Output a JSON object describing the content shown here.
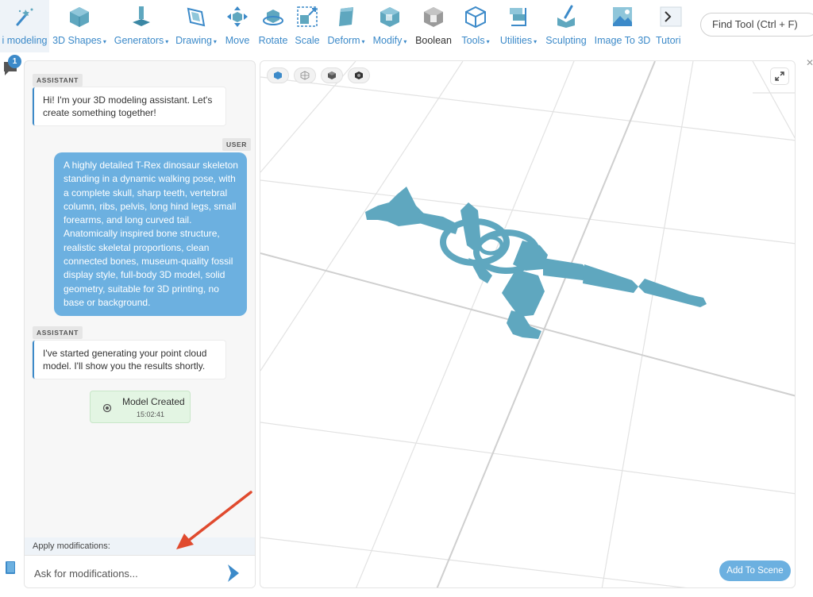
{
  "toolbar": {
    "tools": [
      {
        "label": "i modeling",
        "caret": false
      },
      {
        "label": "3D Shapes",
        "caret": true
      },
      {
        "label": "Generators",
        "caret": true
      },
      {
        "label": "Drawing",
        "caret": true
      },
      {
        "label": "Move",
        "caret": false
      },
      {
        "label": "Rotate",
        "caret": false
      },
      {
        "label": "Scale",
        "caret": false
      },
      {
        "label": "Deform",
        "caret": true
      },
      {
        "label": "Modify",
        "caret": true
      },
      {
        "label": "Boolean",
        "caret": false
      },
      {
        "label": "Tools",
        "caret": true
      },
      {
        "label": "Utilities",
        "caret": true
      },
      {
        "label": "Sculpting",
        "caret": false
      },
      {
        "label": "Image To 3D",
        "caret": false
      },
      {
        "label": "Tutori",
        "caret": false
      }
    ],
    "caret_glyph": "▾",
    "find_tool": "Find Tool (Ctrl + F)"
  },
  "sidebar": {
    "badge_count": "1"
  },
  "chat": {
    "messages": [
      {
        "role": "ASSISTANT",
        "text": "Hi! I'm your 3D modeling assistant. Let's create something together!"
      },
      {
        "role": "USER",
        "text": "A highly detailed T-Rex dinosaur skeleton standing in a dynamic walking pose, with a complete skull, sharp teeth, vertebral column, ribs, pelvis, long hind legs, small forearms, and long curved tail. Anatomically inspired bone structure, realistic skeletal proportions, clean connected bones, museum-quality fossil display style, full-body 3D model, solid geometry, suitable for 3D printing, no base or background."
      },
      {
        "role": "ASSISTANT",
        "text": "I've started generating your point cloud model. I'll show you the results shortly."
      }
    ],
    "model_card": {
      "title": "Model Created",
      "time": "15:02:41"
    },
    "apply_label": "Apply modifications:",
    "input_placeholder": "Ask for modifications..."
  },
  "viewport": {
    "add_to_scene": "Add To Scene",
    "model_color": "#5fa7bf"
  },
  "colors": {
    "accent": "#3c8ac9",
    "user_bubble": "#6cb0e0",
    "success_bg": "#e3f5e3"
  }
}
